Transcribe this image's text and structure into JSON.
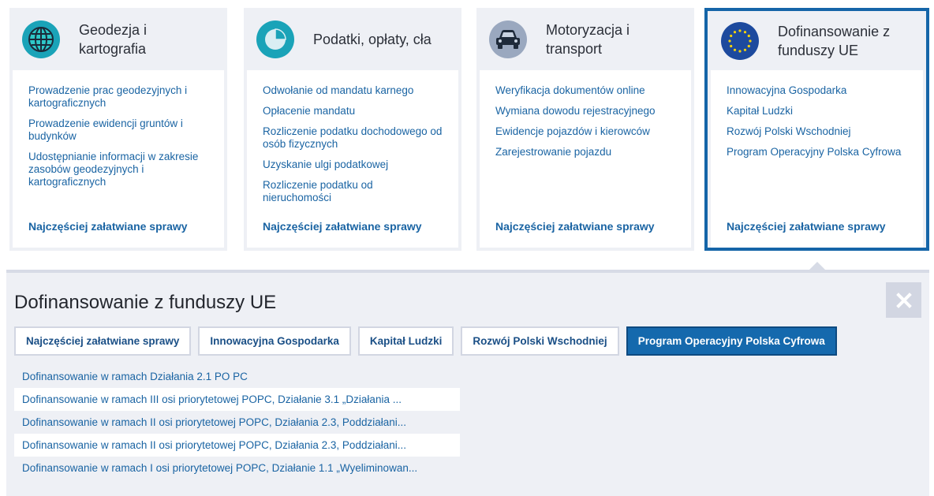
{
  "cards": [
    {
      "title": "Geodezja i kartografia",
      "icon": "globe-icon",
      "links": [
        "Prowadzenie prac geodezyjnych i kartograficznych",
        "Prowadzenie ewidencji gruntów i budynków",
        "Udostępnianie informacji w zakresie zasobów geodezyjnych i kartograficznych"
      ],
      "more": "Najczęściej załatwiane sprawy"
    },
    {
      "title": "Podatki, opłaty, cła",
      "icon": "pie-chart-icon",
      "links": [
        "Odwołanie od mandatu karnego",
        "Opłacenie mandatu",
        "Rozliczenie podatku dochodowego od osób fizycznych",
        "Uzyskanie ulgi podatkowej",
        "Rozliczenie podatku od nieruchomości"
      ],
      "more": "Najczęściej załatwiane sprawy"
    },
    {
      "title": "Motoryzacja i transport",
      "icon": "car-icon",
      "links": [
        "Weryfikacja dokumentów online",
        "Wymiana dowodu rejestracyjnego",
        "Ewidencje pojazdów i kierowców",
        "Zarejestrowanie pojazdu"
      ],
      "more": "Najczęściej załatwiane sprawy"
    },
    {
      "title": "Dofinansowanie z funduszy UE",
      "icon": "eu-flag-icon",
      "links": [
        "Innowacyjna Gospodarka",
        "Kapitał Ludzki",
        "Rozwój Polski Wschodniej",
        "Program Operacyjny Polska Cyfrowa"
      ],
      "more": "Najczęściej załatwiane sprawy"
    }
  ],
  "panel": {
    "title": "Dofinansowanie z funduszy UE",
    "tabs": [
      "Najczęściej załatwiane sprawy",
      "Innowacyjna Gospodarka",
      "Kapitał Ludzki",
      "Rozwój Polski Wschodniej",
      "Program Operacyjny Polska Cyfrowa"
    ],
    "active_tab": 4,
    "items": [
      "Dofinansowanie w ramach Działania 2.1 PO PC",
      "Dofinansowanie w ramach III osi priorytetowej POPC, Działanie 3.1 „Działania ...",
      "Dofinansowanie w ramach II osi priorytetowej POPC, Działania 2.3, Poddziałani...",
      "Dofinansowanie w ramach II osi priorytetowej POPC, Działania 2.3, Poddziałani...",
      "Dofinansowanie w ramach I osi priorytetowej POPC, Działanie 1.1 „Wyeliminowan..."
    ]
  },
  "colors": {
    "accent": "#1569ad",
    "link": "#1a64a3",
    "card_bg": "#eef0f5",
    "selected_border": "#1565a8"
  }
}
